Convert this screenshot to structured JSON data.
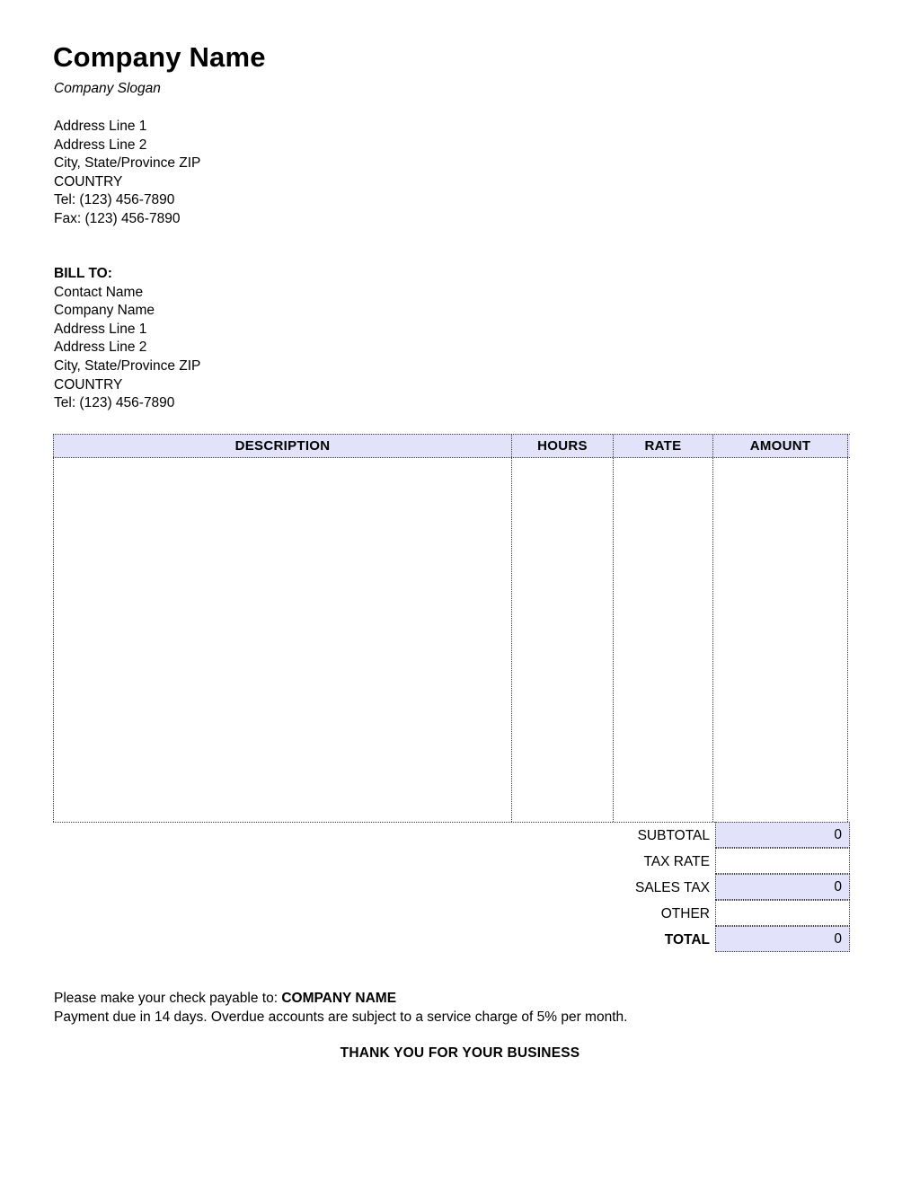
{
  "document": {
    "type": "invoice-template",
    "page_background": "#ffffff",
    "accent_fill": "#e2e2fa",
    "border_color": "#3a3a3a"
  },
  "company": {
    "name": "Company Name",
    "slogan": "Company Slogan",
    "address": [
      "Address Line 1",
      "Address Line 2",
      "City, State/Province ZIP",
      "COUNTRY",
      "Tel: (123) 456-7890",
      "Fax: (123) 456-7890"
    ]
  },
  "bill_to": {
    "label": "BILL TO:",
    "lines": [
      "Contact Name",
      "Company Name",
      "Address Line 1",
      "Address Line 2",
      "City, State/Province ZIP",
      "COUNTRY",
      "Tel: (123) 456-7890"
    ]
  },
  "line_items_table": {
    "columns": [
      {
        "key": "description",
        "label": "DESCRIPTION"
      },
      {
        "key": "hours",
        "label": "HOURS"
      },
      {
        "key": "rate",
        "label": "RATE"
      },
      {
        "key": "amount",
        "label": "AMOUNT"
      }
    ],
    "rows": []
  },
  "totals": [
    {
      "label": "SUBTOTAL",
      "value": "0",
      "filled": true,
      "bold": false
    },
    {
      "label": "TAX RATE",
      "value": "",
      "filled": false,
      "bold": false
    },
    {
      "label": "SALES TAX",
      "value": "0",
      "filled": true,
      "bold": false
    },
    {
      "label": "OTHER",
      "value": "",
      "filled": false,
      "bold": false
    },
    {
      "label": "TOTAL",
      "value": "0",
      "filled": true,
      "bold": true
    }
  ],
  "footer": {
    "payable_prefix": "Please make your check payable to: ",
    "payable_name": "COMPANY NAME",
    "terms": "Payment due in 14 days. Overdue accounts are subject to a service charge of 5% per month.",
    "thank_you": "THANK YOU FOR YOUR BUSINESS"
  }
}
